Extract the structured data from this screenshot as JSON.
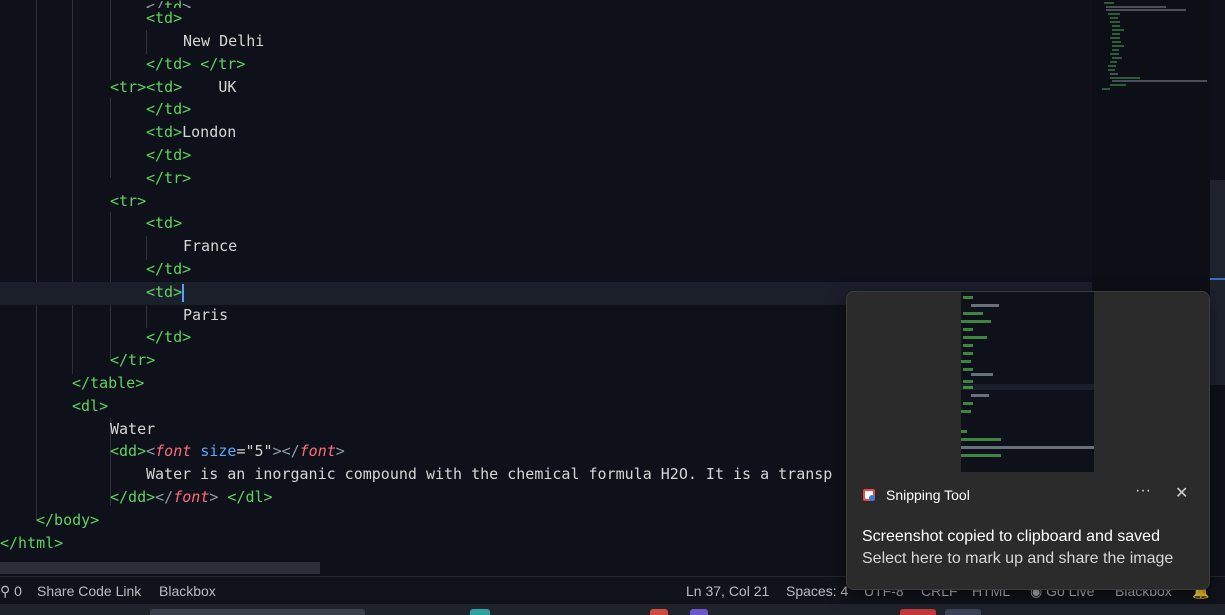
{
  "editor": {
    "lines": {
      "l1": {
        "td_open": "<td>"
      },
      "l2": {
        "text": "New Delhi"
      },
      "l3": {
        "td_close": "</td>",
        "tr_close": "</tr>"
      },
      "l4": {
        "tr_open": "<tr>",
        "td_open": "<td>",
        "text": "UK"
      },
      "l5": {
        "td_close": "</td>"
      },
      "l6": {
        "td_open": "<td>",
        "text": "London"
      },
      "l7": {
        "td_close": "</td>"
      },
      "l8": {
        "tr_close": "</tr>"
      },
      "l9": {
        "tr_open": "<tr>"
      },
      "l10": {
        "td_open": "<td>"
      },
      "l11": {
        "text": "France"
      },
      "l12": {
        "td_close": "</td>"
      },
      "l13": {
        "td_open": "<td>"
      },
      "l14": {
        "text": "Paris"
      },
      "l15": {
        "td_close": "</td>"
      },
      "l16": {
        "tr_close": "</tr>"
      },
      "l17": {
        "table_close": "</table>"
      },
      "l18": {
        "dl_open": "<dl>"
      },
      "l19": {
        "text": "Water"
      },
      "l20": {
        "dd_open": "<dd>",
        "font_lt": "<",
        "font_tag": "font",
        "attr": "size",
        "eq": "=",
        "value": "\"5\"",
        "gt": ">",
        "font_close_lt": "</",
        "font_close_tag": "font",
        "font_close_gt": ">"
      },
      "l21": {
        "text": "Water is an inorganic compound with the chemical formula H2O. It is a transp"
      },
      "l22": {
        "dd_close": "</dd>",
        "font_close_lt": "</",
        "font_close_tag": "font",
        "font_close_gt": ">",
        "dl_close": "</dl>"
      },
      "l23": {
        "body_close": "</body>"
      },
      "l24": {
        "html_close": "</html>"
      }
    }
  },
  "statusbar": {
    "ports": "0",
    "share": "Share Code Link",
    "blackbox": "Blackbox",
    "position": "Ln 37, Col 21",
    "spaces": "Spaces: 4",
    "encoding": "UTF-8",
    "eol": "CRLF",
    "language": "HTML",
    "golive": "Go Live",
    "blackbox2": "Blackbox"
  },
  "toast": {
    "app": "Snipping Tool",
    "more": "···",
    "close": "✕",
    "message": "Screenshot copied to clipboard and saved",
    "sub": "Select here to mark up and share the image"
  },
  "colors": {
    "background": "#0e1119",
    "tag": "#5fd35f",
    "attribute": "#5aa9ff",
    "italic_tag": "#ff6b7a",
    "toast_bg": "#2b2b2b"
  }
}
